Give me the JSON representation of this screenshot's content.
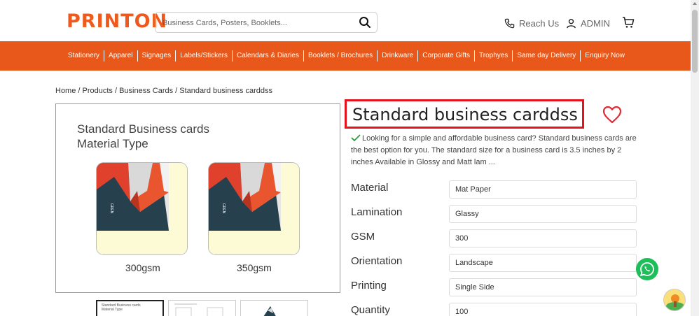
{
  "header": {
    "logo": "PRINTON",
    "search_placeholder": "Business Cards, Posters, Booklets...",
    "reach_us": "Reach Us",
    "admin": "ADMIN"
  },
  "nav": {
    "items": [
      "Stationery",
      "Apparel",
      "Signages",
      "Labels/Stickers",
      "Calendars & Diaries",
      "Booklets / Brochures",
      "Drinkware",
      "Corporate Gifts",
      "Trophyes",
      "Same day Delivery",
      "Enquiry Now"
    ]
  },
  "breadcrumb": "Home / Products / Business Cards / Standard business carddss",
  "image": {
    "title_line1": "Standard Business cards",
    "title_line2": "Material Type",
    "card_brand": "GREN",
    "card1_label": "300gsm",
    "card2_label": "350gsm",
    "thumb1_text_line1": "Standard Business cards",
    "thumb1_text_line2": "Material Type"
  },
  "product": {
    "title": "Standard business carddss",
    "description": "Looking for a simple and affordable business card? Standard business cards are the best option for you. The standard size for a business card is 3.5 inches by 2 inches Available in Glossy and Matt lam ..."
  },
  "options": [
    {
      "label": "Material",
      "value": "Mat Paper"
    },
    {
      "label": "Lamination",
      "value": "Glassy"
    },
    {
      "label": "GSM",
      "value": "300"
    },
    {
      "label": "Orientation",
      "value": "Landscape"
    },
    {
      "label": "Printing",
      "value": "Single Side"
    },
    {
      "label": "Quantity",
      "value": "100"
    }
  ],
  "colors": {
    "brand_orange": "#e8581a",
    "title_highlight": "#e5121c",
    "whatsapp_green": "#1ebe5b"
  }
}
